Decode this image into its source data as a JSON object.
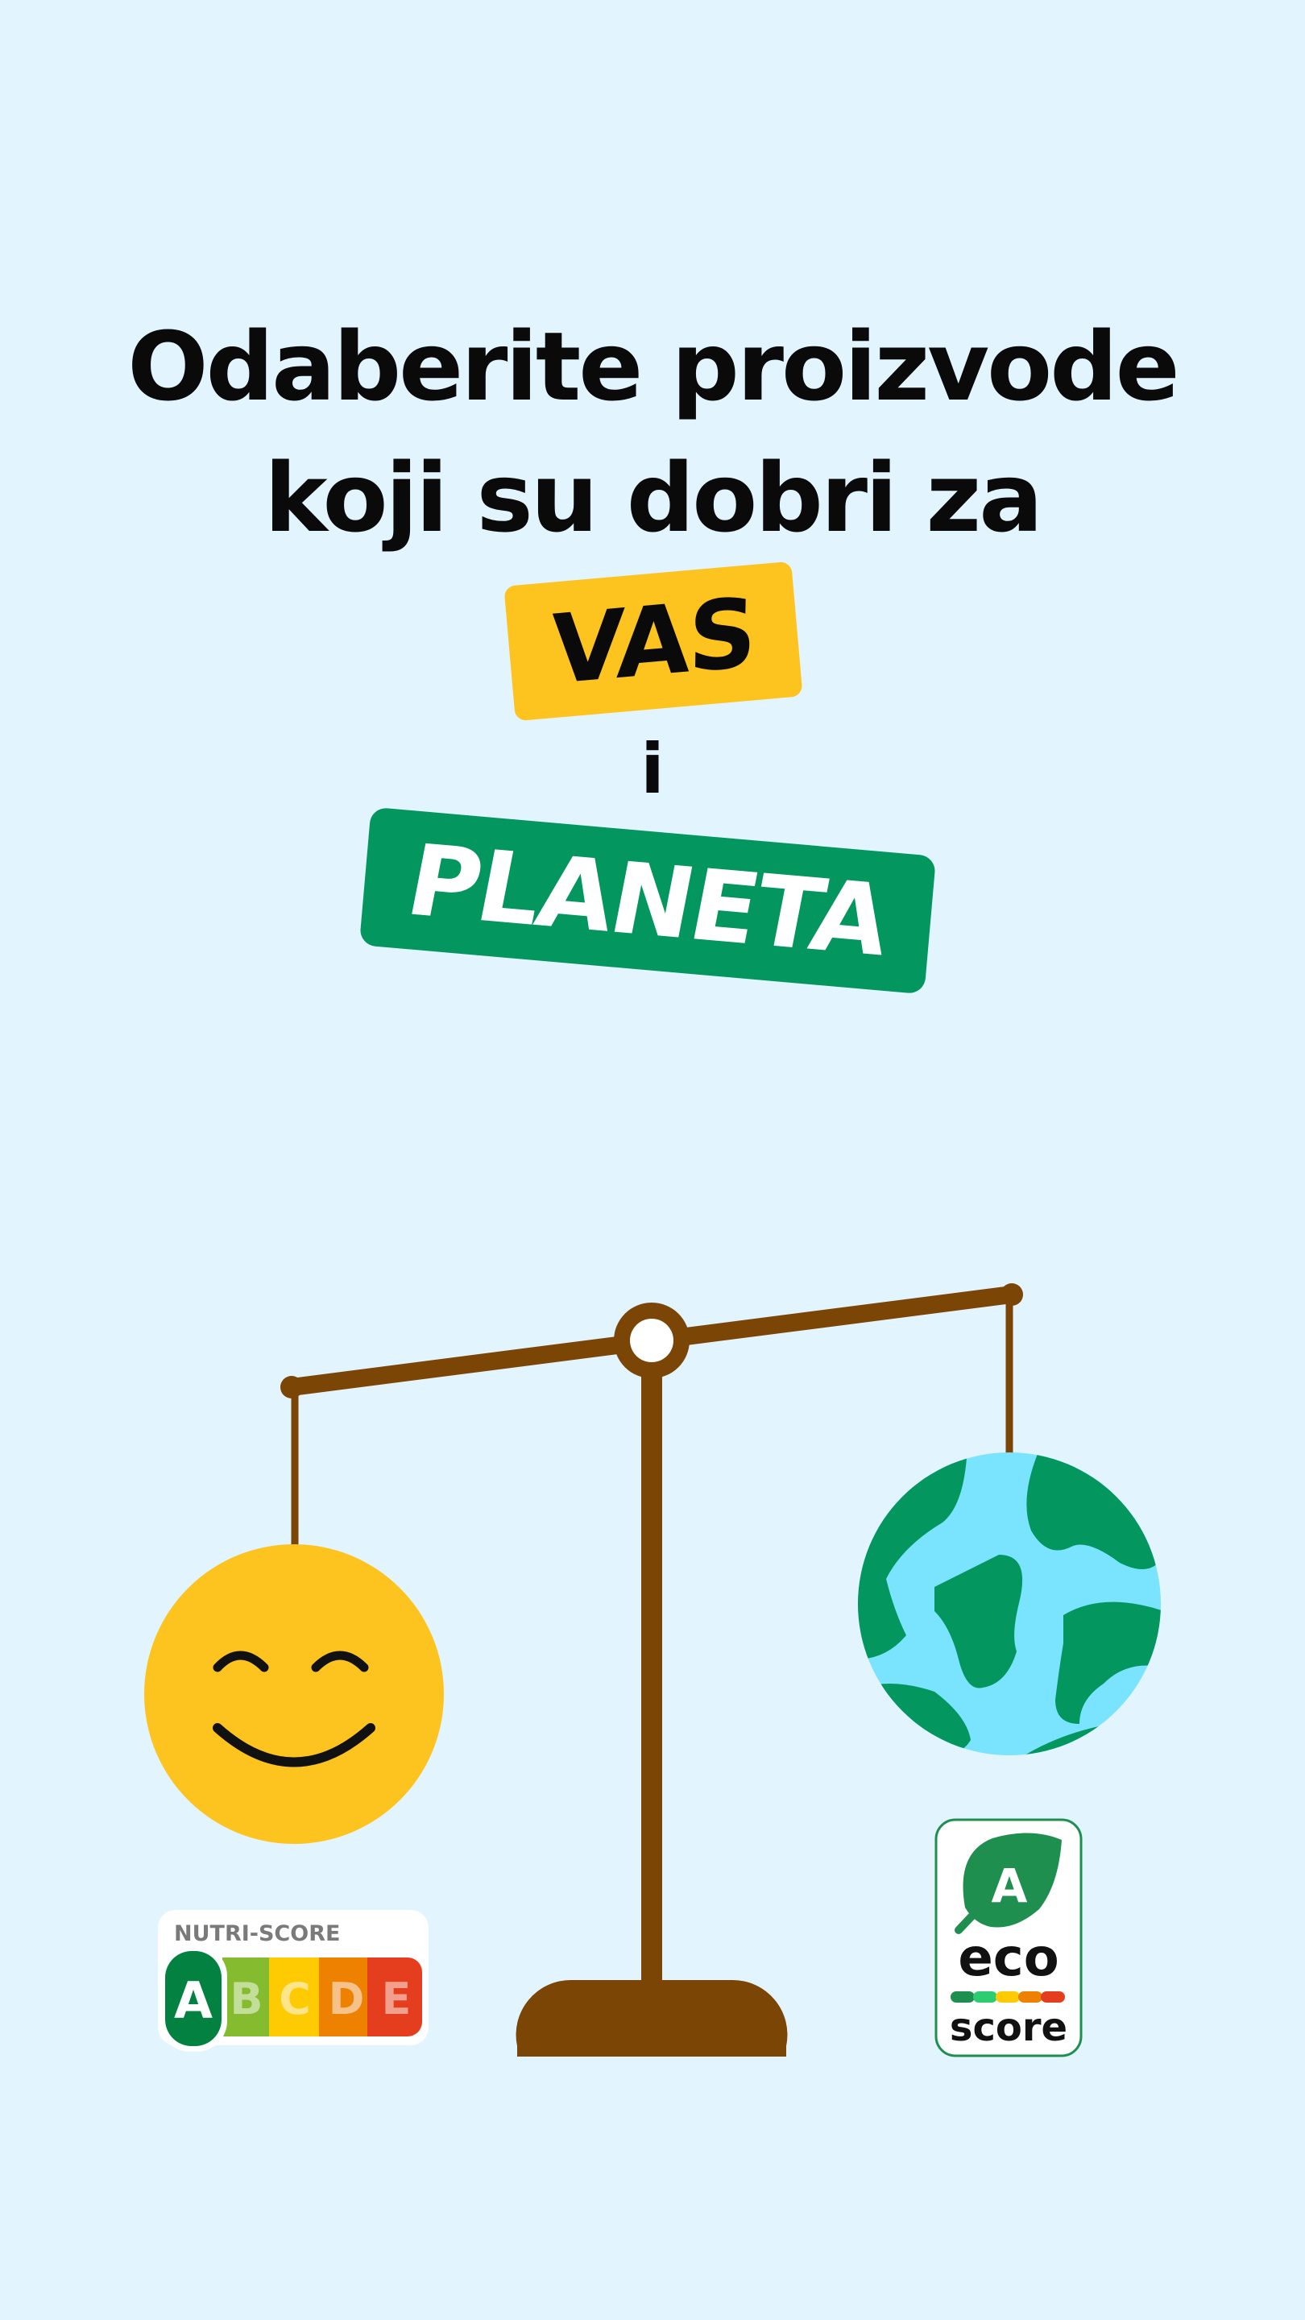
{
  "headline": {
    "line1": "Odaberite proizvode",
    "line2": "koji su dobri za",
    "highlight1": "VAS",
    "conjunction": "i",
    "highlight2": "PLANETA"
  },
  "nutri_score": {
    "title": "NUTRI-SCORE",
    "grades": [
      "A",
      "B",
      "C",
      "D",
      "E"
    ],
    "selected": "A"
  },
  "eco_score": {
    "grade": "A",
    "word1": "eco",
    "word2": "score"
  },
  "colors": {
    "background": "#e2f4fd",
    "yellow": "#fdc31e",
    "green": "#03965f",
    "scale_brown": "#7a4505",
    "ocean": "#7ae3fd",
    "smiley": "#fdc31e"
  },
  "icons": [
    "balance-scale-icon",
    "smiley-face-icon",
    "earth-globe-icon",
    "leaf-icon"
  ]
}
